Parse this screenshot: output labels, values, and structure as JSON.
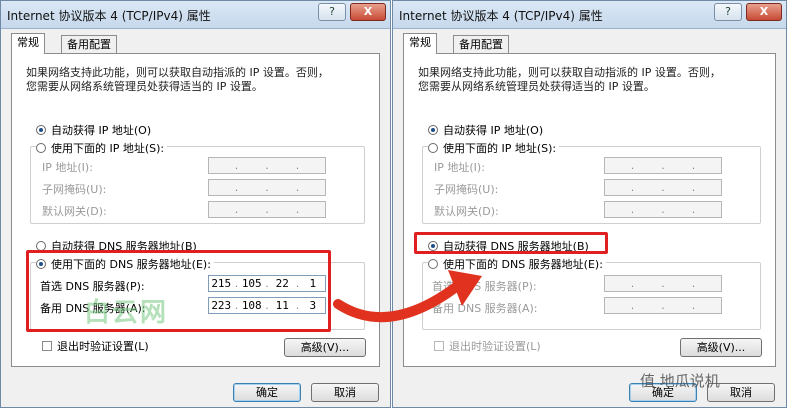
{
  "dialog_title": "Internet 协议版本 4 (TCP/IPv4) 属性",
  "titlebar": {
    "help": "?",
    "close": "X"
  },
  "tabs": [
    "常规",
    "备用配置"
  ],
  "description": [
    "如果网络支持此功能，则可以获取自动指派的 IP 设置。否则，",
    "您需要从网络系统管理员处获得适当的 IP 设置。"
  ],
  "ip_auto": "自动获得 IP 地址(O)",
  "ip_manual": "使用下面的 IP 地址(S):",
  "ip_fields": [
    "IP 地址(I):",
    "子网掩码(U):",
    "默认网关(D):"
  ],
  "dns_auto": "自动获得 DNS 服务器地址(B)",
  "dns_manual": "使用下面的 DNS 服务器地址(E):",
  "dns_fields": [
    "首选 DNS 服务器(P):",
    "备用 DNS 服务器(A):"
  ],
  "left_dns": {
    "preferred": [
      "215",
      "105",
      "22",
      "1"
    ],
    "alternate": [
      "223",
      "108",
      "11",
      "3"
    ]
  },
  "validate_on_exit": "退出时验证设置(L)",
  "advanced": "高级(V)...",
  "ok": "确定",
  "cancel": "取消",
  "watermark_left": "白云网",
  "watermark_right": "值 地瓜说机",
  "colors": {
    "highlight": "#e02020",
    "arrow": "#e0321e"
  }
}
